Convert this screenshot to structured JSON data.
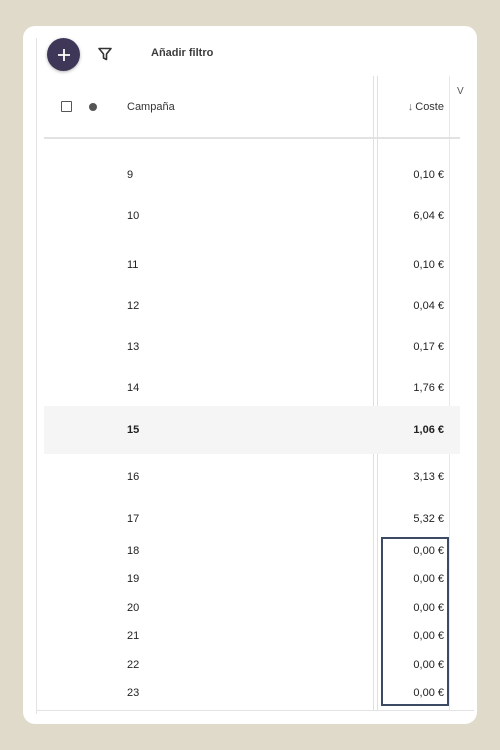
{
  "toolbar": {
    "add_filter_label": "Añadir filtro"
  },
  "header": {
    "campaign_col": "Campaña",
    "cost_col": "Coste",
    "sort_arrow": "↓",
    "next_col_partial": "V"
  },
  "rows": [
    {
      "campaign": "9",
      "cost": "0,10 €"
    },
    {
      "campaign": "10",
      "cost": "6,04 €"
    },
    {
      "campaign": "11",
      "cost": "0,10 €"
    },
    {
      "campaign": "12",
      "cost": "0,04 €"
    },
    {
      "campaign": "13",
      "cost": "0,17 €"
    },
    {
      "campaign": "14",
      "cost": "1,76 €"
    },
    {
      "campaign": "15",
      "cost": "1,06 €"
    },
    {
      "campaign": "16",
      "cost": "3,13 €"
    },
    {
      "campaign": "17",
      "cost": "5,32 €"
    },
    {
      "campaign": "18",
      "cost": "0,00 €"
    },
    {
      "campaign": "19",
      "cost": "0,00 €"
    },
    {
      "campaign": "20",
      "cost": "0,00 €"
    },
    {
      "campaign": "21",
      "cost": "0,00 €"
    },
    {
      "campaign": "22",
      "cost": "0,00 €"
    },
    {
      "campaign": "23",
      "cost": "0,00 €"
    }
  ],
  "colors": {
    "fab": "#3f3758",
    "highlight_border": "#3d4a64",
    "background": "#e0dacb"
  }
}
